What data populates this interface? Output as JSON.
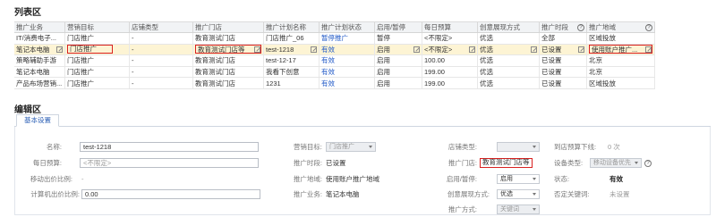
{
  "list_title": "列表区",
  "edit_title": "编辑区",
  "table": {
    "columns": [
      "推广业务",
      "营销目标",
      "店铺类型",
      "推广门店",
      "推广计划名称",
      "推广计划状态",
      "启用/暂停",
      "每日预算",
      "创意展现方式",
      "推广时段",
      "推广地域"
    ],
    "rows": [
      [
        "IT/消费电子...",
        "门店推广",
        "-",
        "教育测试门店",
        "门店推广_06",
        "暂停推广",
        "暂停",
        "<不限定>",
        "优选",
        "全部",
        "区域投放"
      ],
      [
        "笔记本电脑",
        "门店推广",
        "-",
        "教育测试门店等",
        "test-1218",
        "有效",
        "启用",
        "<不限定>",
        "优选",
        "已设置",
        "使用账户推广..."
      ],
      [
        "策略辅助手游",
        "门店推广",
        "-",
        "教育测试门店",
        "test-12-17",
        "有效",
        "启用",
        "100.00",
        "优选",
        "已设置",
        "北京"
      ],
      [
        "笔记本电脑",
        "门店推广",
        "-",
        "教育测试门店",
        "我看下创意",
        "有效",
        "启用",
        "199.00",
        "优选",
        "已设置",
        "北京"
      ],
      [
        "产品布场营销...",
        "门店推广",
        "-",
        "教育测试门店",
        "1231",
        "有效",
        "启用",
        "199.00",
        "优选",
        "已设置",
        "区域投放"
      ]
    ]
  },
  "edit": {
    "tab": "基本设置",
    "name_label": "名称:",
    "name_value": "test-1218",
    "budget_label": "每日预算:",
    "budget_placeholder": "<不限定>",
    "mobile_bid_label": "移动出价比例:",
    "mobile_bid_value": "-",
    "pc_bid_label": "计算机出价比例:",
    "pc_bid_value": "0.00",
    "target_label": "营销目标:",
    "target_value": "门店推广",
    "period_label": "推广时段:",
    "period_value": "已设置",
    "region_label": "推广地域:",
    "region_value": "使用账户推广地域",
    "business_label": "推广业务:",
    "business_value": "笔记本电脑",
    "shop_type_label": "店铺类型:",
    "shop_type_value": "",
    "store_label": "推广门店:",
    "store_value": "教育测试门店等",
    "status_label": "启用/暂停:",
    "status_value": "启用",
    "creative_label": "创意展现方式:",
    "creative_value": "优选",
    "method_label": "推广方式:",
    "method_value": "关键词",
    "store_limit_label": "到店预算下线:",
    "store_limit_value": "0 次",
    "device_label": "设备类型:",
    "device_value": "移动设备优先",
    "state_label": "状态:",
    "state_value": "有效",
    "neg_kw_label": "否定关键词:",
    "neg_kw_value": "未设置"
  }
}
